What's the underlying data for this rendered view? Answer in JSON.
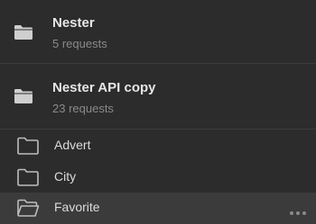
{
  "collections": [
    {
      "name": "Nester",
      "count": "5 requests",
      "icon": "folder-filled-icon"
    },
    {
      "name": "Nester API copy",
      "count": "23 requests",
      "icon": "folder-filled-icon"
    }
  ],
  "folders": [
    {
      "name": "Advert",
      "icon": "folder-outline-icon"
    },
    {
      "name": "City",
      "icon": "folder-outline-icon"
    },
    {
      "name": "Favorite",
      "icon": "folder-open-icon",
      "hovered": true
    }
  ],
  "colors": {
    "background": "#2c2c2c",
    "hover": "#3b3b3b",
    "text": "#e6e6e6",
    "muted": "#8a8a8a",
    "icon": "#bdbdbd"
  }
}
